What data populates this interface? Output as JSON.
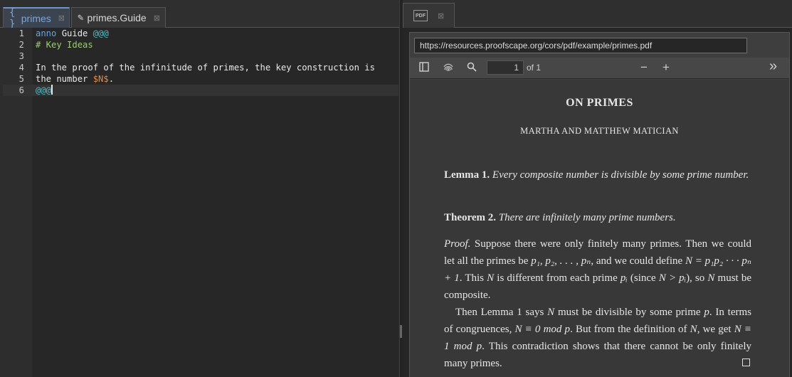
{
  "editor": {
    "tabs": [
      {
        "icon": "{ }",
        "label": "primes",
        "close": "⊠"
      },
      {
        "icon": "✎",
        "label": "primes.Guide",
        "close": "⊠"
      }
    ],
    "lines": [
      {
        "num": "1",
        "parts": [
          {
            "t": "anno",
            "c": "kw"
          },
          {
            "t": " Guide ",
            "c": "tx"
          },
          {
            "t": "@@@",
            "c": "at"
          }
        ]
      },
      {
        "num": "2",
        "parts": [
          {
            "t": "# Key Ideas",
            "c": "hd"
          }
        ]
      },
      {
        "num": "3",
        "parts": []
      },
      {
        "num": "4",
        "parts": [
          {
            "t": "In the proof of the infinitude of primes, the key construction is",
            "c": "tx"
          }
        ]
      },
      {
        "num": "5",
        "parts": [
          {
            "t": "the number ",
            "c": "tx"
          },
          {
            "t": "$N$",
            "c": "math"
          },
          {
            "t": ".",
            "c": "tx"
          }
        ]
      },
      {
        "num": "6",
        "parts": [
          {
            "t": "@@@",
            "c": "at"
          }
        ],
        "current": true
      }
    ]
  },
  "pdf": {
    "tab_badge": "PDF",
    "tab_close": "⊠",
    "url": "https://resources.proofscape.org/cors/pdf/example/primes.pdf",
    "page_current": "1",
    "page_of": "of 1",
    "zoom_out": "−",
    "zoom_in": "+",
    "more": "»",
    "title": "ON PRIMES",
    "authors": "MARTHA AND MATTHEW MATICIAN",
    "lemma_label": "Lemma 1.",
    "lemma_text": "Every composite number is divisible by some prime number.",
    "theorem_label": "Theorem 2.",
    "theorem_text": "There are infinitely many prime numbers.",
    "proof_label": "Proof.",
    "proof_p1_a": "Suppose there were only finitely many primes. Then we could let all the primes be ",
    "proof_p1_list": "p₁, p₂, . . . , pₙ",
    "proof_p1_b": ", and we could define ",
    "proof_p1_def": "N = p₁p₂ · · · pₙ + 1",
    "proof_p1_c": ". This ",
    "proof_p1_N": "N",
    "proof_p1_d": " is different from each prime ",
    "proof_p1_pi": "pᵢ",
    "proof_p1_e": " (since ",
    "proof_p1_ineq": "N > pᵢ",
    "proof_p1_f": "), so ",
    "proof_p1_N2": "N",
    "proof_p1_g": " must be composite.",
    "proof_p2_a": "Then Lemma 1 says ",
    "proof_p2_N": "N",
    "proof_p2_b": " must be divisible by some prime ",
    "proof_p2_p": "p",
    "proof_p2_c": ". In terms of congruences, ",
    "proof_p2_cong0": "N ≡ 0  mod p",
    "proof_p2_d": ". But from the definition of ",
    "proof_p2_N2": "N",
    "proof_p2_e": ", we get ",
    "proof_p2_cong1": "N ≡ 1  mod p",
    "proof_p2_f": ". This contradiction shows that there cannot be only finitely many primes."
  }
}
